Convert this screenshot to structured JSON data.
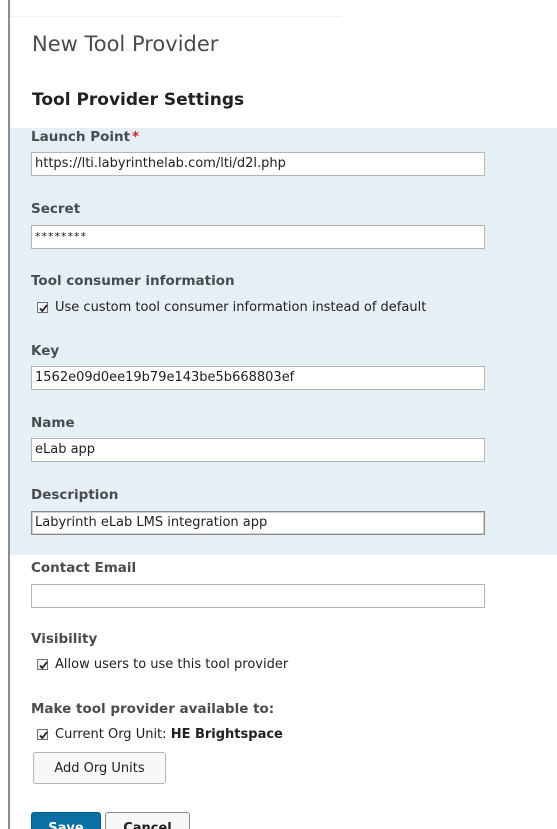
{
  "page": {
    "title": "New Tool Provider",
    "section_title": "Tool Provider Settings"
  },
  "fields": {
    "launch_point": {
      "label": "Launch Point",
      "required_marker": "*",
      "value": "https://lti.labyrinthelab.com/lti/d2l.php"
    },
    "secret": {
      "label": "Secret",
      "value": "********"
    },
    "tool_consumer": {
      "label": "Tool consumer information",
      "checkbox_label": "Use custom tool consumer information instead of default",
      "checked": true
    },
    "key": {
      "label": "Key",
      "value": "1562e09d0ee19b79e143be5b668803ef"
    },
    "name": {
      "label": "Name",
      "value": "eLab app"
    },
    "description": {
      "label": "Description",
      "value": "Labyrinth eLab LMS integration app"
    },
    "contact_email": {
      "label": "Contact Email",
      "value": ""
    },
    "visibility": {
      "label": "Visibility",
      "checkbox_label": "Allow users to use this tool provider",
      "checked": true
    },
    "availability": {
      "label": "Make tool provider available to:",
      "checkbox_label": "Current Org Unit:",
      "org_unit": "HE Brightspace",
      "checked": true
    }
  },
  "buttons": {
    "add_org_units": "Add Org Units",
    "save": "Save",
    "cancel": "Cancel"
  },
  "colors": {
    "highlight_band": "#e6eff3",
    "primary": "#0a6fa3",
    "required": "#cd2026"
  }
}
